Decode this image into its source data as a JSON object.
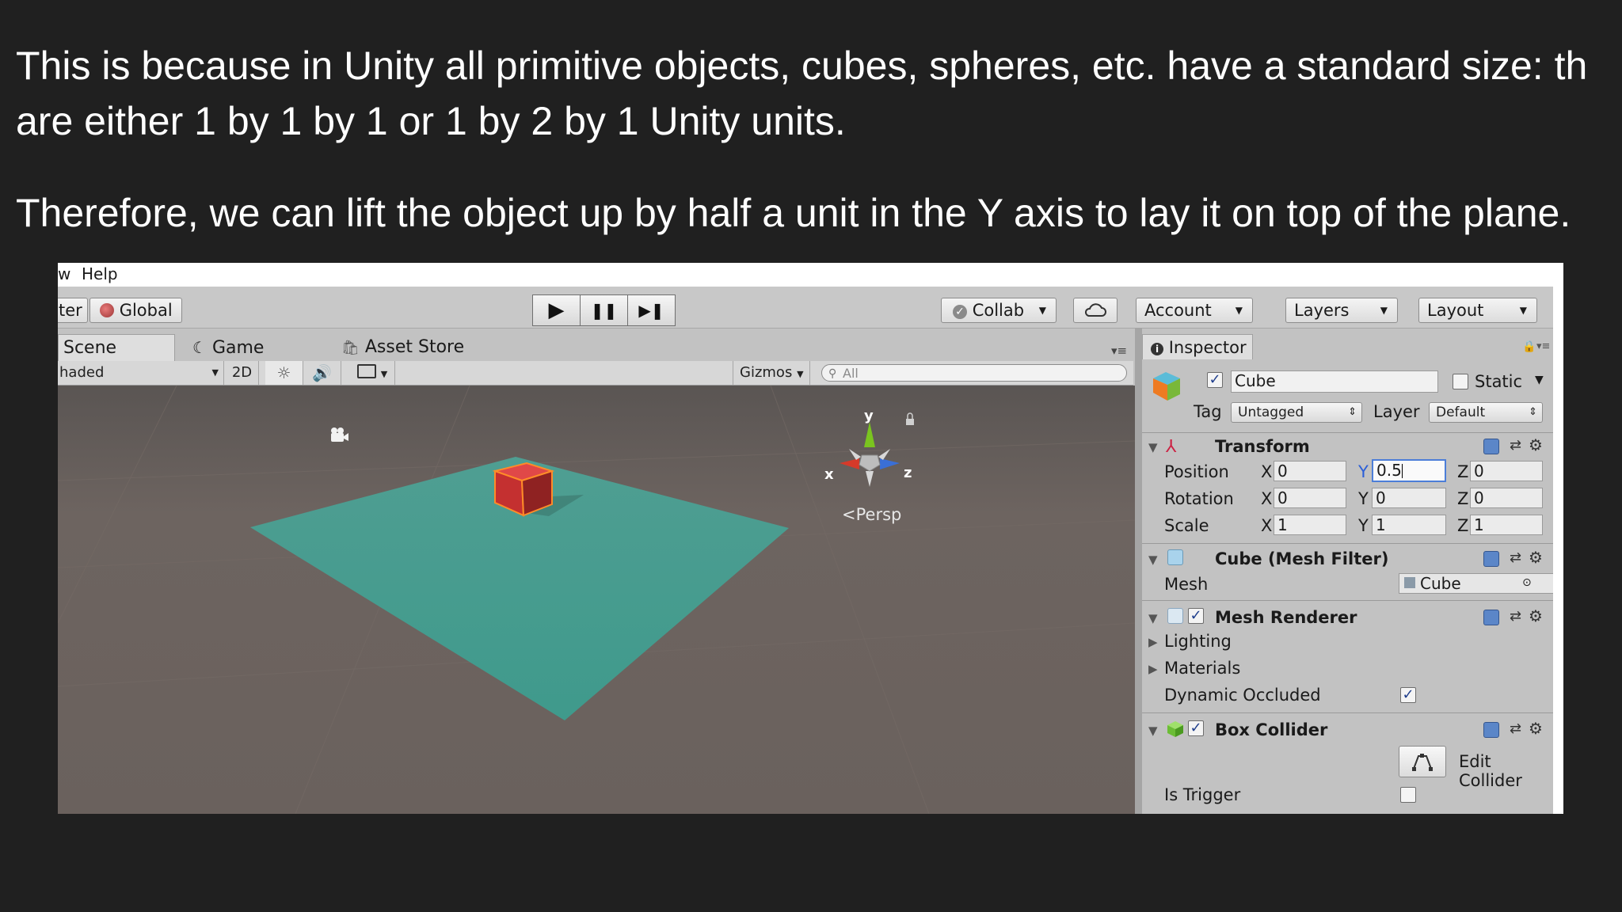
{
  "slide": {
    "line1": "This is because in Unity all primitive objects, cubes, spheres, etc. have a standard size: th",
    "line2": "are either 1 by 1 by 1 or 1 by 2 by 1 Unity units.",
    "line3": "Therefore, we can lift the object up by half a unit in the Y axis to lay it on top of the plane."
  },
  "menubar": {
    "items": [
      "w",
      "Help"
    ]
  },
  "toolbar": {
    "pivot_label": "ter",
    "global_label": "Global",
    "play_icon": "▶",
    "pause_icon": "❚❚",
    "step_icon": "▶❚",
    "collab_label": "Collab",
    "account_label": "Account",
    "layers_label": "Layers",
    "layout_label": "Layout"
  },
  "tabs": {
    "scene": "Scene",
    "game": "Game",
    "asset_store": "Asset Store",
    "inspector": "Inspector"
  },
  "scene_toolbar": {
    "shading": "haded",
    "two_d": "2D",
    "gizmos": "Gizmos",
    "search_placeholder": "All"
  },
  "scene_view": {
    "gizmo_y": "y",
    "gizmo_x": "x",
    "gizmo_z": "z",
    "persp": "Persp",
    "colors": {
      "ground": "#6a615d",
      "plane": "#4aa396",
      "cube": "#c93232"
    }
  },
  "inspector": {
    "object_name": "Cube",
    "active": true,
    "static_label": "Static",
    "static": false,
    "tag_label": "Tag",
    "tag_value": "Untagged",
    "layer_label": "Layer",
    "layer_value": "Default",
    "transform": {
      "title": "Transform",
      "rows": [
        {
          "label": "Position",
          "x": "0",
          "y": "0.5",
          "z": "0"
        },
        {
          "label": "Rotation",
          "x": "0",
          "y": "0",
          "z": "0"
        },
        {
          "label": "Scale",
          "x": "1",
          "y": "1",
          "z": "1"
        }
      ],
      "axis_x": "X",
      "axis_y": "Y",
      "axis_z": "Z"
    },
    "mesh_filter": {
      "title": "Cube (Mesh Filter)",
      "mesh_label": "Mesh",
      "mesh_value": "Cube"
    },
    "mesh_renderer": {
      "title": "Mesh Renderer",
      "enabled": true,
      "lighting": "Lighting",
      "materials": "Materials",
      "dynamic_occluded": "Dynamic Occluded"
    },
    "box_collider": {
      "title": "Box Collider",
      "enabled": true,
      "edit_collider": "Edit Collider",
      "is_trigger": "Is Trigger"
    }
  }
}
